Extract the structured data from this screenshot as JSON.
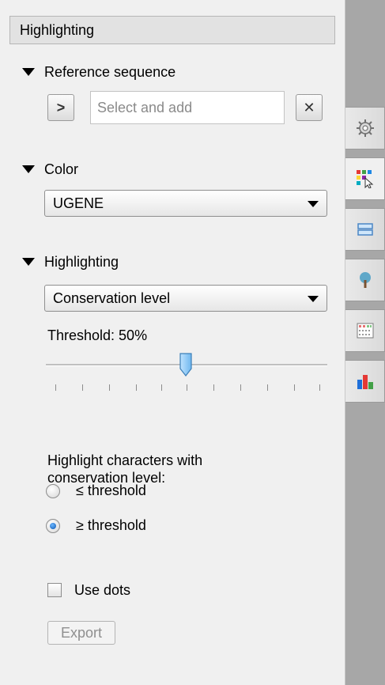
{
  "panel": {
    "header_title": "Highlighting"
  },
  "reference": {
    "title": "Reference sequence",
    "select_button_label": ">",
    "input_placeholder": "Select and add",
    "clear_button_label": "✕"
  },
  "color": {
    "title": "Color",
    "selected": "UGENE"
  },
  "highlighting": {
    "title": "Highlighting",
    "selected": "Conservation level",
    "threshold_label": "Threshold: 50%",
    "threshold_value_percent": 50,
    "description": "Highlight characters with conservation level:",
    "options": [
      "≤ threshold",
      "≥ threshold"
    ],
    "selected_option_index": 1,
    "use_dots_label": "Use dots",
    "use_dots_checked": false,
    "export_label": "Export"
  },
  "side_tabs": {
    "icons": [
      "settings-gear-icon",
      "highlighting-icon",
      "sequence-layout-icon",
      "tree-icon",
      "statistics-grid-icon",
      "bar-chart-icon"
    ],
    "active_index": 1
  }
}
